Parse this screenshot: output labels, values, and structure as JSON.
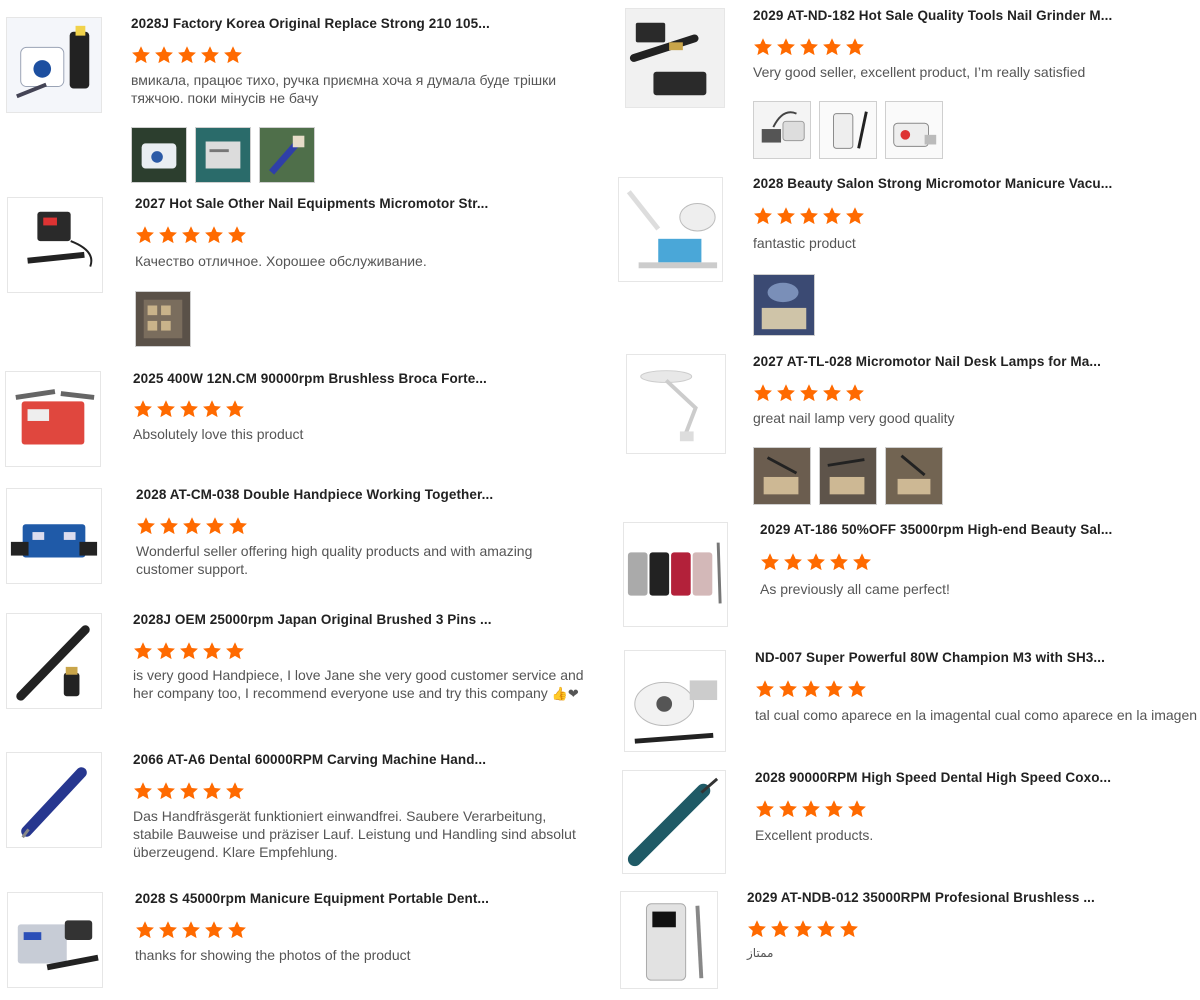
{
  "accent": "#ff6a00",
  "reviews": [
    {
      "title": "2028J Factory Korea Original Replace Strong 210 105...",
      "rating": 5,
      "text": "вмикала, працює тихо, ручка приємна хоча я думала буде трішки тяжчою. поки мінусів не бачу",
      "photos": [
        "photo-machine",
        "photo-box",
        "photo-handpiece"
      ]
    },
    {
      "title": "2029 AT-ND-182 Hot Sale Quality Tools Nail Grinder M...",
      "rating": 5,
      "text": "Very good seller, excellent product, I’m really satisfied",
      "photos": [
        "photo-pedal",
        "photo-machine",
        "photo-machine"
      ]
    },
    {
      "title": "2027 Hot Sale Other Nail Equipments Micromotor Str...",
      "rating": 5,
      "text": "Качество отличное. Хорошее обслуживание.",
      "photos": [
        "photo-store"
      ]
    },
    {
      "title": "2028 Beauty Salon Strong Micromotor Manicure Vacu...",
      "rating": 5,
      "text": "fantastic product",
      "photos": [
        "photo-lamp"
      ]
    },
    {
      "title": "2025 400W 12N.CM 90000rpm Brushless Broca Forte...",
      "rating": 5,
      "text": "Absolutely love this product",
      "photos": []
    },
    {
      "title": "2027 AT-TL-028 Micromotor Nail Desk Lamps for Ma...",
      "rating": 5,
      "text": "great nail lamp very good quality",
      "photos": [
        "photo-lamp",
        "photo-lamp",
        "photo-lamp"
      ]
    },
    {
      "title": "2028 AT-CM-038 Double Handpiece Working Together...",
      "rating": 5,
      "text": "Wonderful seller offering high quality products and with amazing customer support.",
      "photos": []
    },
    {
      "title": "2029 AT-186 50%OFF 35000rpm High-end Beauty Sal...",
      "rating": 5,
      "text": "As previously all came perfect!",
      "photos": []
    },
    {
      "title": "2028J OEM 25000rpm Japan Original Brushed 3 Pins ...",
      "rating": 5,
      "text": "is very good Handpiece, I love Jane she very good customer service and her company too, I recommend everyone use and try this company",
      "emoji": "👍❤",
      "photos": []
    },
    {
      "title": "ND-007 Super Powerful 80W Champion M3 with SH3...",
      "rating": 5,
      "text": "tal cual como aparece en la imagental cual como aparece en la imagen",
      "photos": []
    },
    {
      "title": "2066 AT-A6 Dental 60000RPM Carving Machine Hand...",
      "rating": 5,
      "text": "Das Handfräsgerät funktioniert einwandfrei. Saubere Verarbeitung, stabile Bauweise und präziser Lauf. Leistung und Handling sind absolut überzeugend. Klare Empfehlung.",
      "photos": []
    },
    {
      "title": "2028 90000RPM High Speed Dental High Speed Coxo...",
      "rating": 5,
      "text": "Excellent products.",
      "photos": []
    },
    {
      "title": "2028 S 45000rpm Manicure Equipment Portable Dent...",
      "rating": 5,
      "text": "thanks for showing the photos of the product",
      "photos": []
    },
    {
      "title": "2029 AT-NDB-012 35000RPM Profesional Brushless ...",
      "rating": 5,
      "text": "ممتاز",
      "photos": []
    }
  ]
}
